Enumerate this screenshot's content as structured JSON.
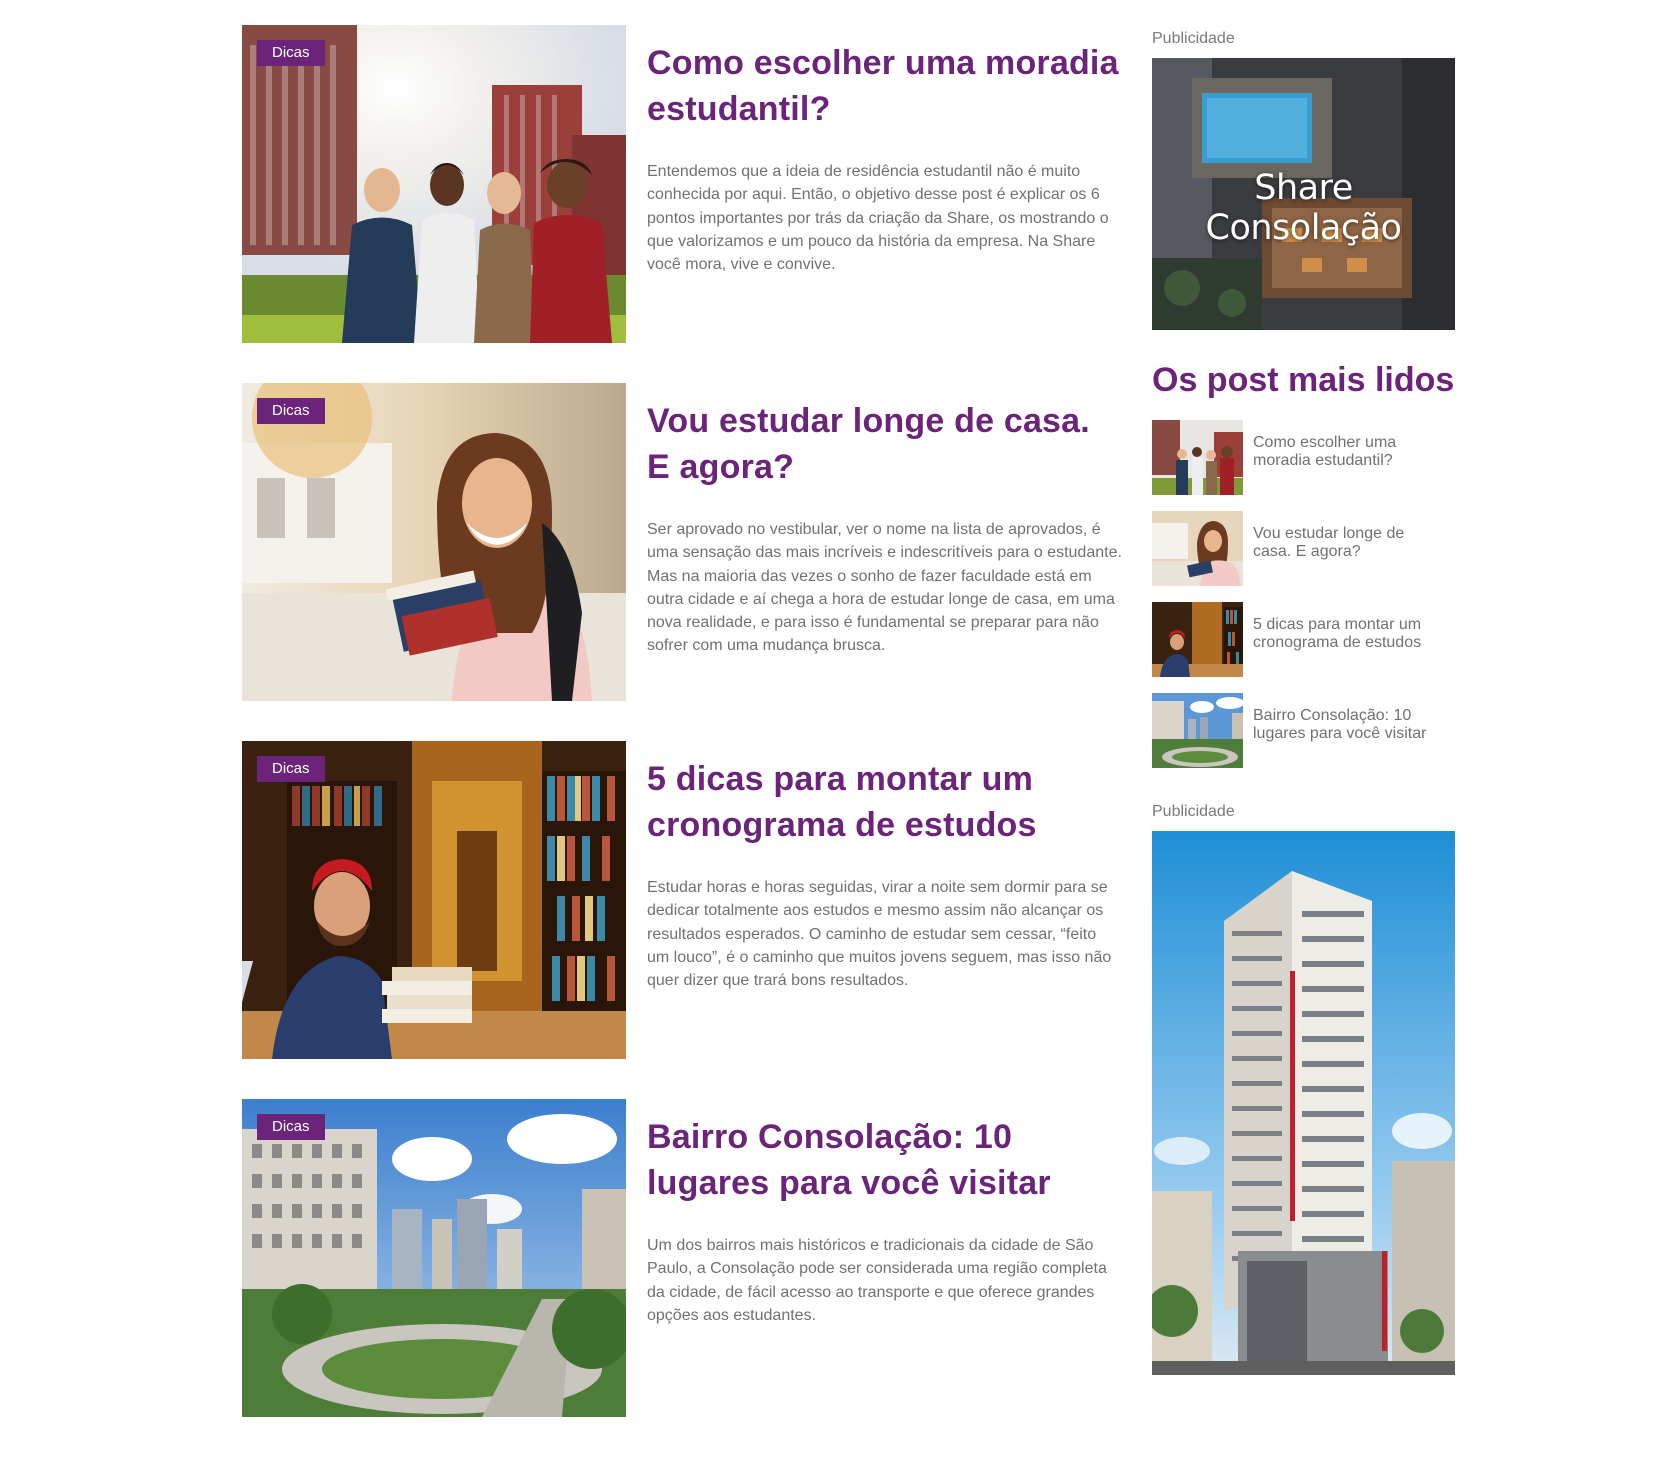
{
  "posts": [
    {
      "tag": "Dicas",
      "title": "Como escolher uma moradia estudantil?",
      "excerpt": "Entendemos que a ideia de residência estudantil não é muito conhecida por aqui. Então, o objetivo desse post é explicar os 6 pontos importantes por trás da criação da Share, os mostrando o que valorizamos e um pouco da história da empresa. Na Share você mora, vive e convive."
    },
    {
      "tag": "Dicas",
      "title": "Vou estudar longe de casa. E agora?",
      "excerpt": "Ser aprovado no vestibular, ver o nome na lista de aprovados, é uma sensação das mais incríveis e indescritíveis para o estudante. Mas na maioria das vezes o sonho de fazer faculdade está em outra cidade e aí chega a hora de estudar longe de casa, em uma nova realidade, e para isso é fundamental se preparar para não sofrer com uma mudança brusca."
    },
    {
      "tag": "Dicas",
      "title": "5 dicas para montar um cronograma de estudos",
      "excerpt": "Estudar horas e horas seguidas, virar a noite sem dormir para se dedicar totalmente aos estudos e mesmo assim não alcançar os resultados esperados. O caminho de estudar sem cessar, “feito um louco”, é o caminho que muitos jovens seguem, mas isso não quer dizer que trará bons resultados."
    },
    {
      "tag": "Dicas",
      "title": "Bairro Consolação: 10 lugares para você visitar",
      "excerpt": "Um dos bairros mais históricos e tradicionais da cidade de São Paulo, a Consolação pode ser considerada uma região completa da cidade, de fácil acesso ao transporte e que oferece grandes opções aos estudantes."
    }
  ],
  "sidebar": {
    "ad1_label": "Publicidade",
    "ad1_caption": "Share Consolação",
    "popular_title": "Os post mais lidos",
    "popular": [
      "Como escolher uma moradia estudantil?",
      "Vou estudar longe de casa. E agora?",
      "5 dicas para montar um cronograma de estudos",
      "Bairro Consolação: 10 lugares para você visitar"
    ],
    "ad2_label": "Publicidade"
  },
  "colors": {
    "accent": "#6b2479",
    "text": "#717171",
    "label": "#7a7a7a"
  }
}
